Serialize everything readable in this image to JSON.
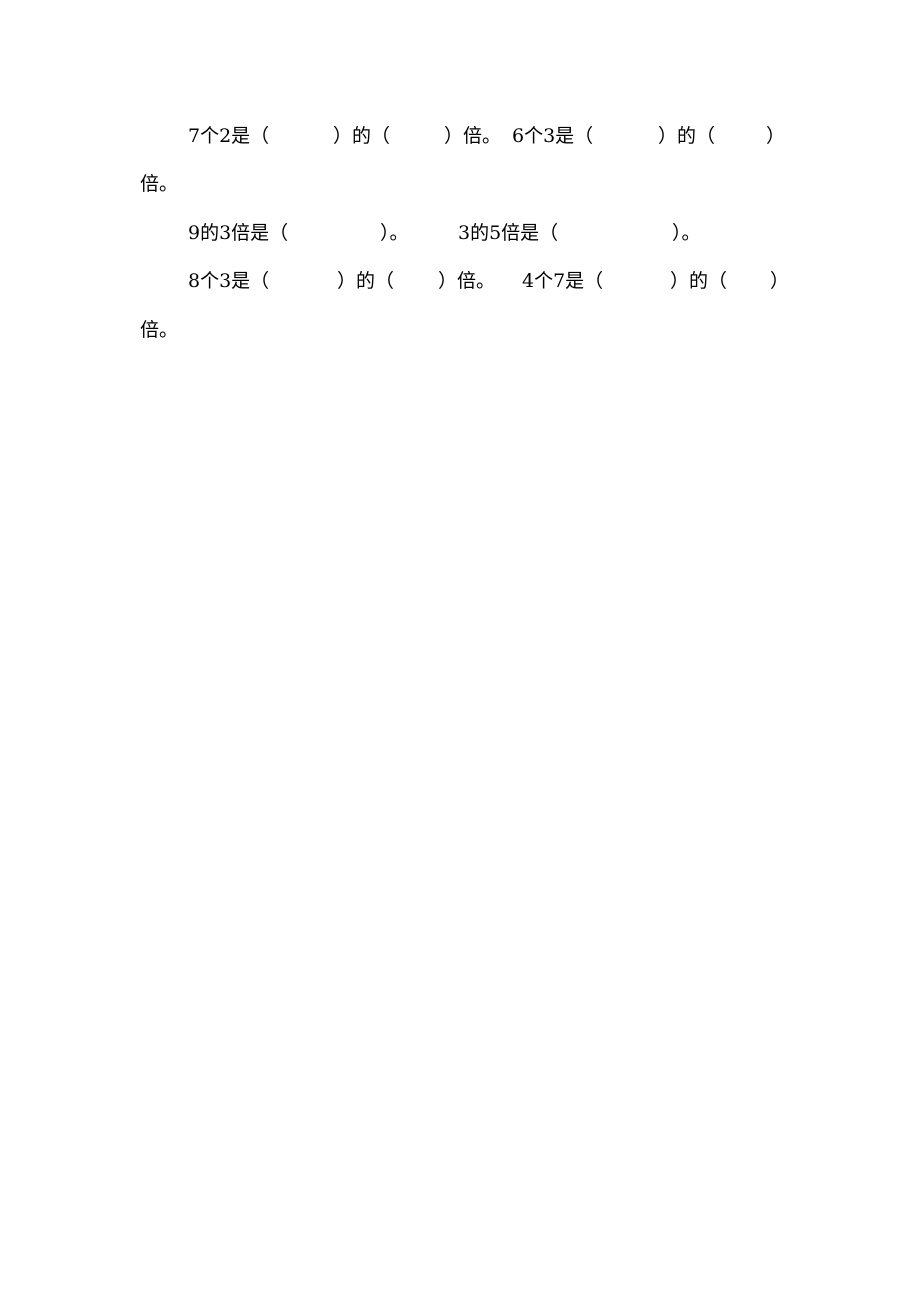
{
  "document": {
    "questions": [
      {
        "id": "q1",
        "segments": [
          "7个2是（",
          "）的（",
          "）倍。",
          "6个3是（",
          "）的（",
          "）"
        ],
        "continuation": "倍。"
      },
      {
        "id": "q2",
        "segments": [
          "9的3倍是（",
          "）。",
          "3的5倍是（",
          "）。"
        ]
      },
      {
        "id": "q3",
        "segments": [
          "8个3是（",
          "）的（",
          "）倍。",
          "4个7是（",
          "）的（",
          "）"
        ],
        "continuation": "倍。"
      }
    ]
  }
}
